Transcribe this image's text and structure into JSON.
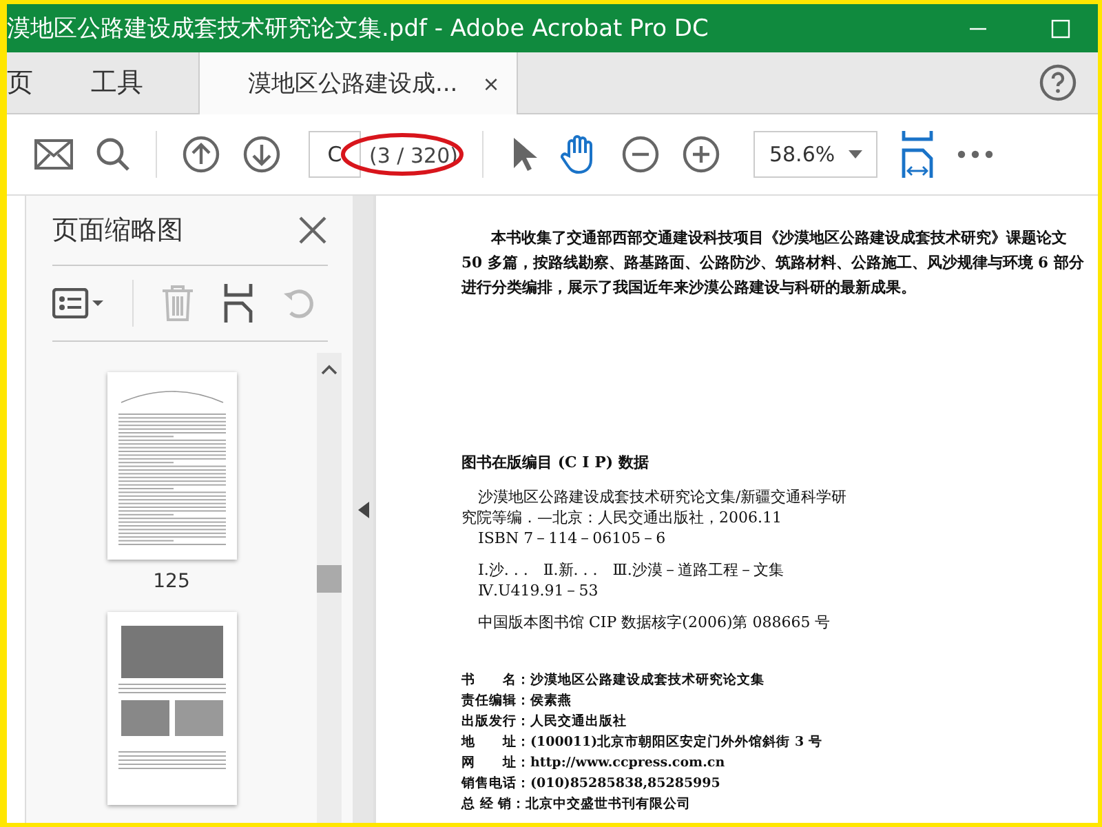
{
  "window": {
    "title": "漠地区公路建设成套技术研究论文集.pdf - Adobe Acrobat Pro DC"
  },
  "tabs": [
    {
      "label": "页",
      "selected": false
    },
    {
      "label": "工具",
      "selected": false
    },
    {
      "label": "漠地区公路建设成...",
      "selected": true,
      "close": "×"
    }
  ],
  "toolbar": {
    "page_field": {
      "value": "C"
    },
    "page_count": "(3 / 320)",
    "zoom": "58.6%",
    "tools": [
      {
        "kind": "select",
        "selected": false
      },
      {
        "kind": "hand",
        "selected": true
      }
    ]
  },
  "sidebar": {
    "title": "页面缩略图",
    "thumbnails": [
      {
        "kind": "text",
        "label": "125"
      },
      {
        "kind": "photos"
      }
    ]
  },
  "document": {
    "abstract": "本书收集了交通部西部交通建设科技项目《沙漠地区公路建设成套技术研究》课题论文50 多篇，按路线勘察、路基路面、公路防沙、筑路材料、公路施工、风沙规律与环境 6 部分进行分类编排，展示了我国近年来沙漠公路建设与科研的最新成果。",
    "cip_heading": "图书在版编目 (C I P) 数据",
    "cip_lines": [
      "沙漠地区公路建设成套技术研究论文集/新疆交通科学研究院等编．—北京：人民交通出版社，2006.11",
      "ISBN 7－114－06105－6",
      "Ⅰ.沙. . .　Ⅱ.新. . .　Ⅲ.沙漠－道路工程－文集",
      "Ⅳ.U419.91－53"
    ],
    "cip_number": "中国版本图书馆 CIP 数据核字(2006)第 088665 号",
    "colophon": [
      {
        "label": "书　　名：",
        "value": "沙漠地区公路建设成套技术研究论文集"
      },
      {
        "label": "责任编辑：",
        "value": "侯素燕"
      },
      {
        "label": "出版发行：",
        "value": "人民交通出版社"
      },
      {
        "label": "地　　址：",
        "value": "(100011)北京市朝阳区安定门外外馆斜街 3 号"
      },
      {
        "label": "网　　址：",
        "value": "http://www.ccpress.com.cn"
      },
      {
        "label": "销售电话：",
        "value": "(010)85285838,85285995"
      },
      {
        "label": "总 经 销：",
        "value": "北京中交盛世书刊有限公司"
      }
    ]
  }
}
